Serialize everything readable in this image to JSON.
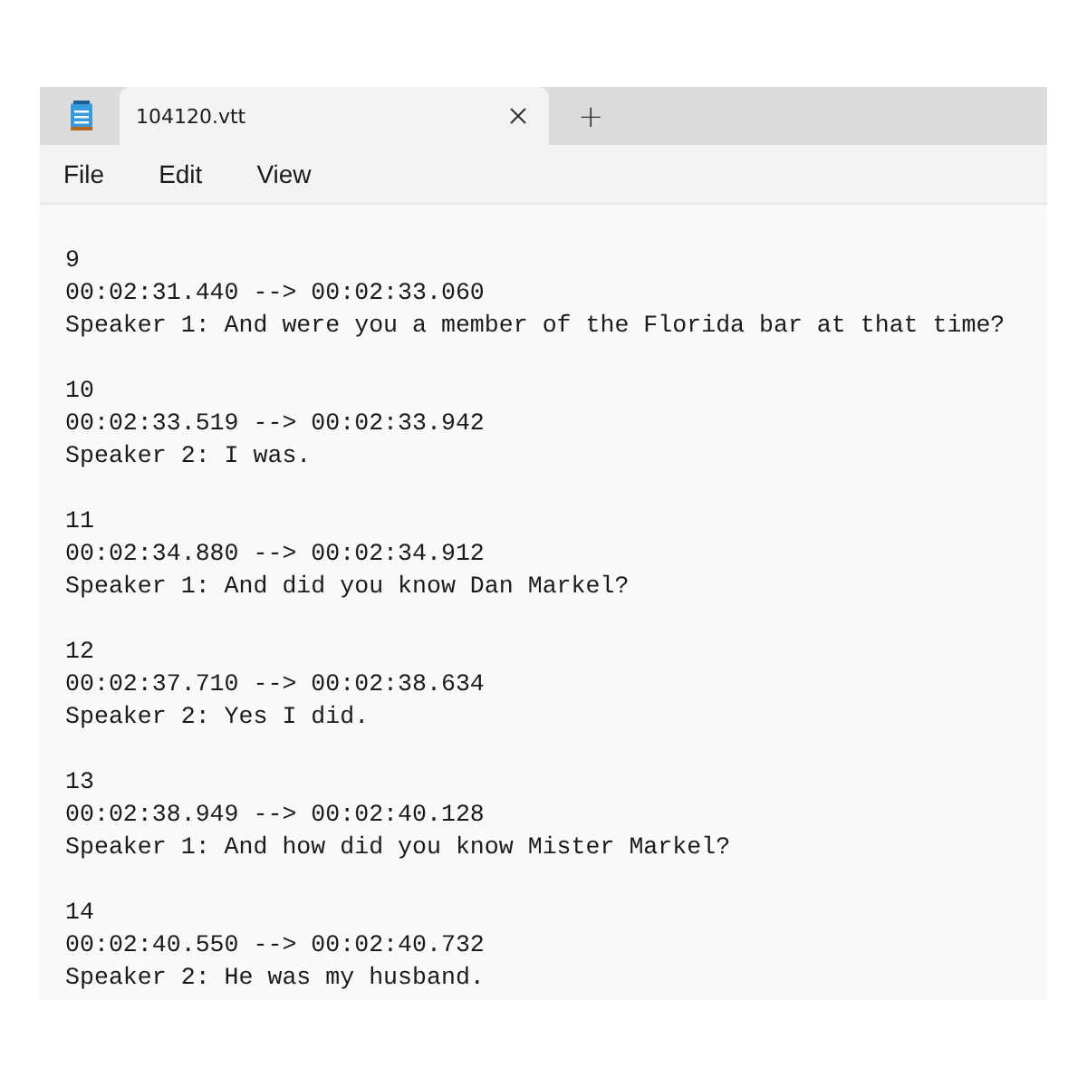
{
  "tabs": [
    {
      "label": "104120.vtt",
      "selected": true
    }
  ],
  "new_tab": "+",
  "menu": [
    "File",
    "Edit",
    "View"
  ],
  "cues": [
    {
      "index": "9",
      "timing": "00:02:31.440 --> 00:02:33.060",
      "text": "Speaker 1: And were you a member of the Florida bar at that time?"
    },
    {
      "index": "10",
      "timing": "00:02:33.519 --> 00:02:33.942",
      "text": "Speaker 2: I was."
    },
    {
      "index": "11",
      "timing": "00:02:34.880 --> 00:02:34.912",
      "text": "Speaker 1: And did you know Dan Markel?"
    },
    {
      "index": "12",
      "timing": "00:02:37.710 --> 00:02:38.634",
      "text": "Speaker 2: Yes I did."
    },
    {
      "index": "13",
      "timing": "00:02:38.949 --> 00:02:40.128",
      "text": "Speaker 1: And how did you know Mister Markel?"
    },
    {
      "index": "14",
      "timing": "00:02:40.550 --> 00:02:40.732",
      "text": "Speaker 2: He was my husband."
    }
  ]
}
